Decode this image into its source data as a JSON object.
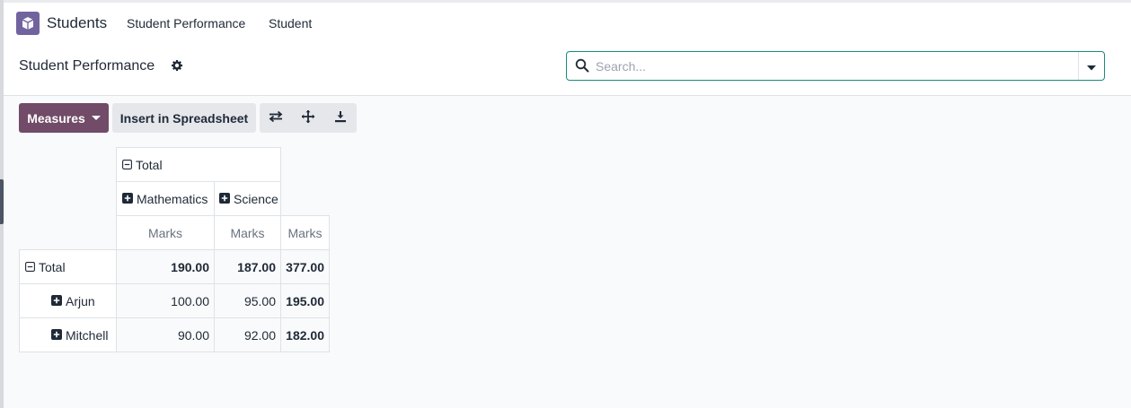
{
  "app": {
    "name": "Students",
    "menu": [
      "Student Performance",
      "Student"
    ]
  },
  "page": {
    "title": "Student Performance"
  },
  "search": {
    "placeholder": "Search...",
    "value": ""
  },
  "toolbar": {
    "measures_label": "Measures",
    "insert_label": "Insert in Spreadsheet",
    "icons": [
      "flip-axis-icon",
      "expand-all-icon",
      "download-icon"
    ]
  },
  "pivot": {
    "col_total_label": "Total",
    "col_groups": [
      "Mathematics",
      "Science"
    ],
    "measure_label": "Marks",
    "rows": [
      {
        "label": "Total",
        "values": [
          "190.00",
          "187.00",
          "377.00"
        ]
      },
      {
        "label": "Arjun",
        "values": [
          "100.00",
          "95.00",
          "195.00"
        ]
      },
      {
        "label": "Mitchell",
        "values": [
          "90.00",
          "92.00",
          "182.00"
        ]
      }
    ]
  },
  "colors": {
    "primary": "#714b67",
    "app_icon": "#71639e",
    "search_border": "#1a8a7f"
  }
}
